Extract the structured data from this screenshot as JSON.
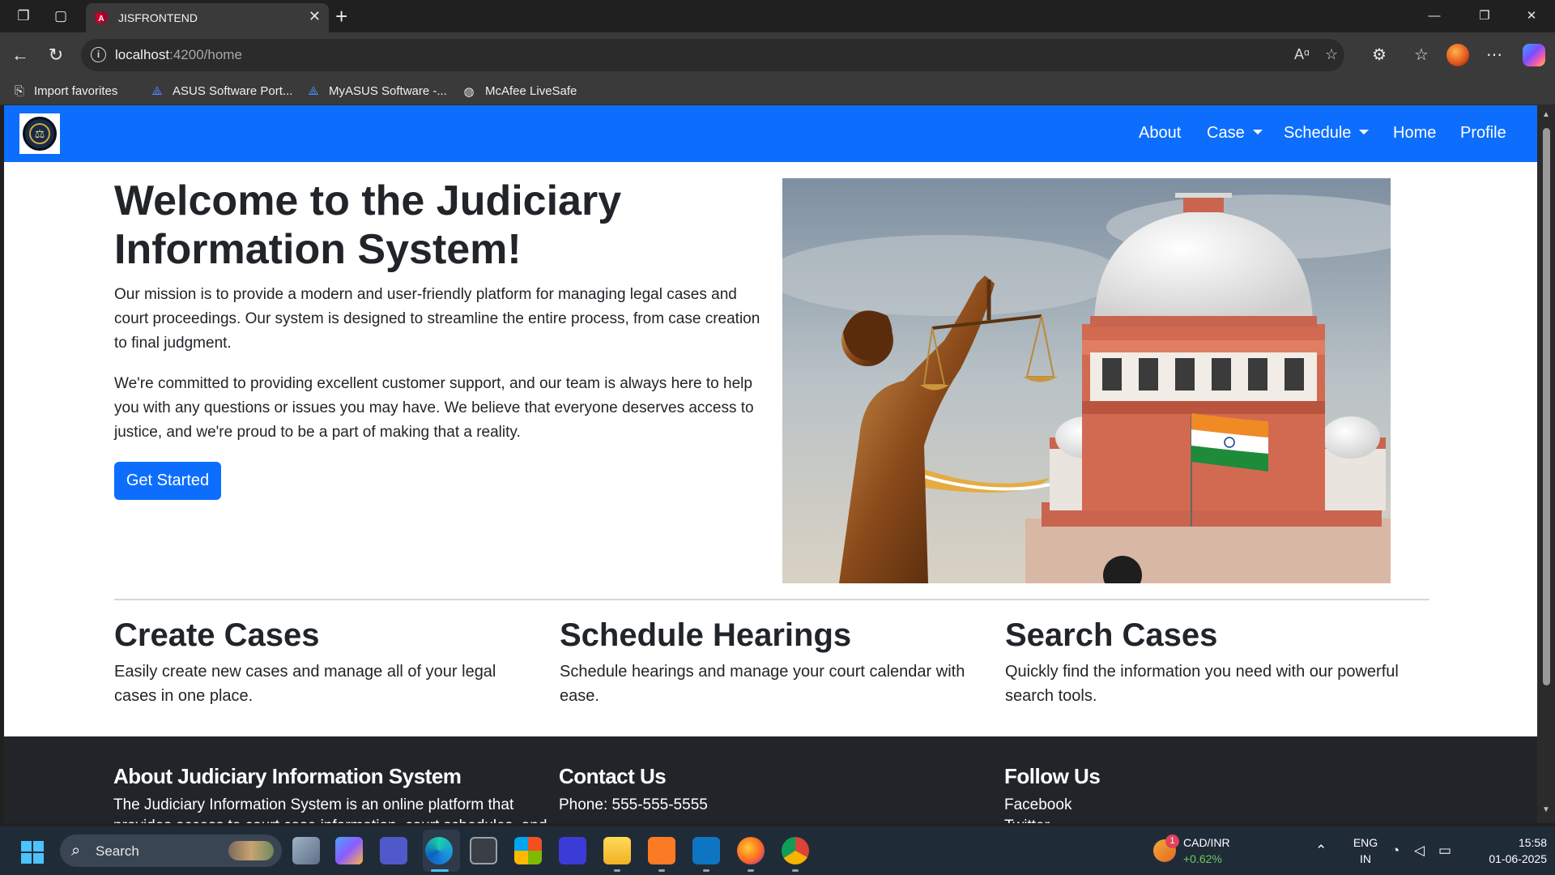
{
  "browser": {
    "tab_title": "JISFRONTEND",
    "url_host": "localhost",
    "url_path": ":4200/home",
    "favorites": [
      {
        "label": "Import favorites"
      },
      {
        "label": "ASUS Software Port..."
      },
      {
        "label": "MyASUS Software -..."
      },
      {
        "label": "McAfee LiveSafe"
      }
    ]
  },
  "navbar": {
    "links": {
      "about": "About",
      "case": "Case",
      "schedule": "Schedule",
      "home": "Home",
      "profile": "Profile"
    },
    "color": "#0d6efd"
  },
  "hero": {
    "title": "Welcome to the Judiciary Information System!",
    "para1": "Our mission is to provide a modern and user-friendly platform for managing legal cases and court proceedings. Our system is designed to streamline the entire process, from case creation to final judgment.",
    "para2": "We're committed to providing excellent customer support, and our team is always here to help you with any questions or issues you may have. We believe that everyone deserves access to justice, and we're proud to be a part of making that a reality.",
    "cta": "Get Started"
  },
  "features": [
    {
      "title": "Create Cases",
      "text": "Easily create new cases and manage all of your legal cases in one place."
    },
    {
      "title": "Schedule Hearings",
      "text": "Schedule hearings and manage your court calendar with ease."
    },
    {
      "title": "Search Cases",
      "text": "Quickly find the information you need with our powerful search tools."
    }
  ],
  "footer": {
    "about_title": "About Judiciary Information System",
    "about_text": "The Judiciary Information System is an online platform that provides access to court case information, court schedules, and",
    "contact_title": "Contact Us",
    "contact_phone": "Phone: 555-555-5555",
    "follow_title": "Follow Us",
    "follow_link1": "Facebook",
    "follow_link2": "Twitter"
  },
  "taskbar": {
    "search_label": "Search",
    "ticker_name": "CAD/INR",
    "ticker_change": "+0.62%",
    "ticker_badge": "1",
    "lang_top": "ENG",
    "lang_bottom": "IN",
    "time": "15:58",
    "date": "01-06-2025"
  }
}
